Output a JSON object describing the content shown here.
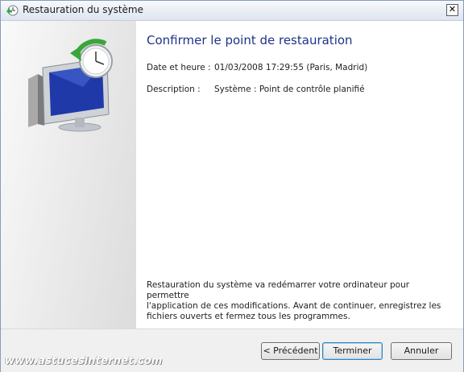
{
  "window": {
    "title": "Restauration du système",
    "close_symbol": "✕",
    "icon": "system-restore-icon"
  },
  "main": {
    "heading": "Confirmer le point de restauration",
    "date_label": "Date et heure :",
    "date_value": "01/03/2008 17:29:55 (Paris, Madrid)",
    "description_label": "Description :",
    "description_value": "Système : Point de contrôle planifié",
    "info_text": "Restauration du système va redémarrer votre ordinateur pour permettre\nl'application de ces modifications. Avant de continuer, enregistrez les\nfichiers ouverts et fermez tous les programmes."
  },
  "footer": {
    "previous_label": "< Précédent",
    "finish_label": "Terminer",
    "cancel_label": "Annuler"
  },
  "watermark": {
    "text": "www.astucesinternet.com"
  },
  "colors": {
    "heading": "#1e3287",
    "accent_green": "#3aa63a",
    "monitor_blue": "#1f3aa8"
  }
}
